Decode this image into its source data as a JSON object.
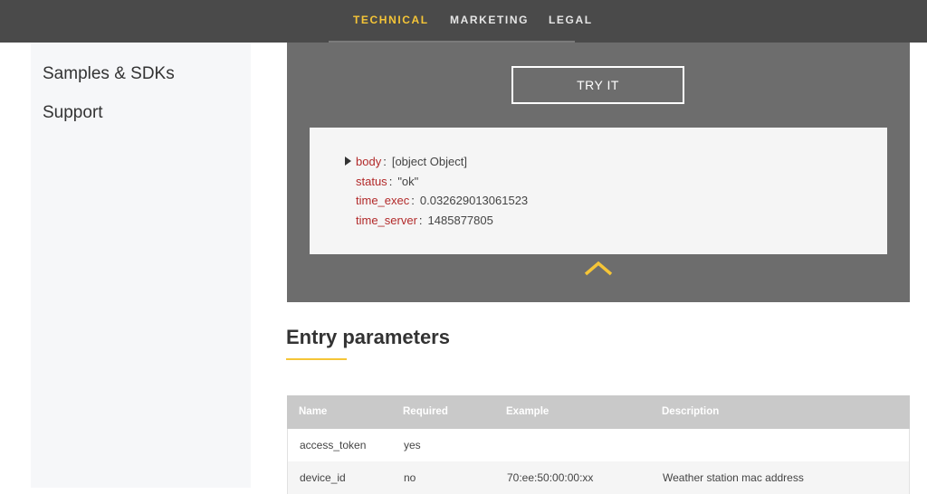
{
  "topnav": {
    "items": [
      {
        "label": "TECHNICAL",
        "active": true
      },
      {
        "label": "MARKETING",
        "active": false
      },
      {
        "label": "LEGAL",
        "active": false
      }
    ]
  },
  "sidebar": {
    "items": [
      {
        "label": "Samples & SDKs"
      },
      {
        "label": "Support"
      }
    ]
  },
  "console": {
    "try_label": "TRY IT",
    "result": [
      {
        "key": "body",
        "value": "[object Object]"
      },
      {
        "key": "status",
        "value": "\"ok\""
      },
      {
        "key": "time_exec",
        "value": "0.032629013061523"
      },
      {
        "key": "time_server",
        "value": "1485877805"
      }
    ]
  },
  "entry": {
    "title": "Entry parameters",
    "headers": [
      "Name",
      "Required",
      "Example",
      "Description"
    ],
    "rows": [
      [
        "access_token",
        "yes",
        "",
        ""
      ],
      [
        "device_id",
        "no",
        "70:ee:50:00:00:xx",
        "Weather station mac address"
      ]
    ]
  },
  "colors": {
    "accent": "#f5c537",
    "topbar": "#4a4a4a",
    "console_bg": "#6d6d6d",
    "key_color": "#b22a2a"
  }
}
